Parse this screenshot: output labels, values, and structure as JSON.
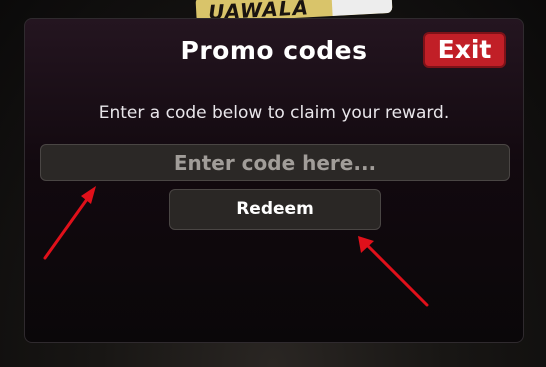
{
  "background": {
    "logo_text": "UAWALA"
  },
  "dialog": {
    "title": "Promo codes",
    "exit_label": "Exit",
    "instruction": "Enter a code below to claim your reward.",
    "code_input": {
      "placeholder": "Enter code here...",
      "value": ""
    },
    "redeem_label": "Redeem"
  },
  "annotations": {
    "arrow_color": "#e0101a",
    "arrow_count": 2
  },
  "colors": {
    "exit_button": "#c11f27",
    "panel_top": "#241520",
    "panel_bottom": "#0a0709",
    "input_bg": "#2b2826",
    "button_bg": "#2a2725"
  }
}
